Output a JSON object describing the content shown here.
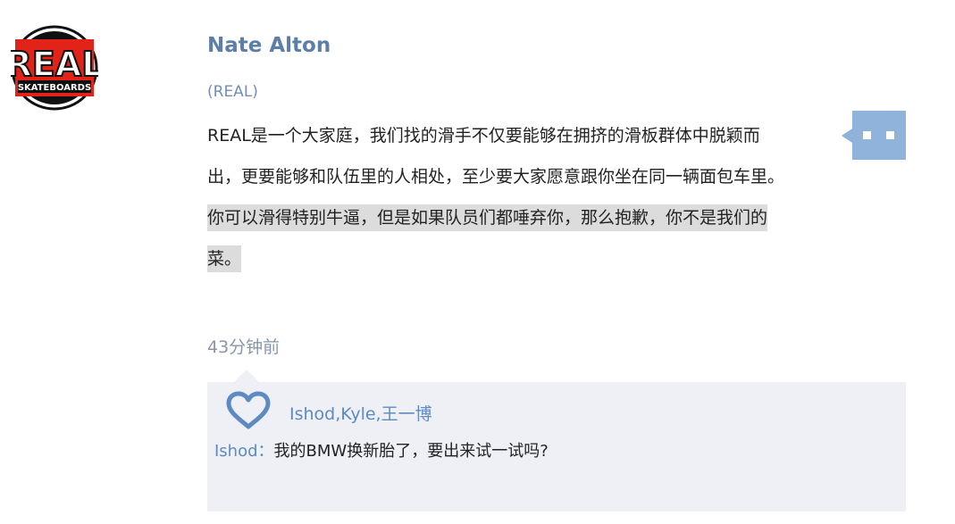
{
  "post": {
    "logo": {
      "text_top": "REAL",
      "text_bottom": "SKATEBOARDS",
      "colors": {
        "red": "#e2231a",
        "black": "#111111",
        "white": "#ffffff"
      }
    },
    "author": "Nate Alton",
    "team": "(REAL)",
    "lines": [
      "REAL是一个大家庭，我们找的滑手不仅要能够在拥挤的滑板群体中脱颖而",
      "出，更要能够和队伍里的人相处，至少要大家愿意跟你坐在同一辆面包车里。",
      "你可以滑得特别牛逼，但是如果队员们都唾弃你，那么抱歉，你不是我们的",
      "菜。"
    ],
    "timestamp": "43分钟前",
    "comment_icon": "comment-bubble-icon",
    "comment_icon_color": "#8fb3da"
  },
  "interactions": {
    "like_icon": "heart-icon",
    "like_color": "#5d8ac0",
    "likers": "Ishod,Kyle,王一博",
    "comments": [
      {
        "user": "Ishod：",
        "text": "我的BMW换新胎了，要出来试一试吗?"
      }
    ]
  }
}
